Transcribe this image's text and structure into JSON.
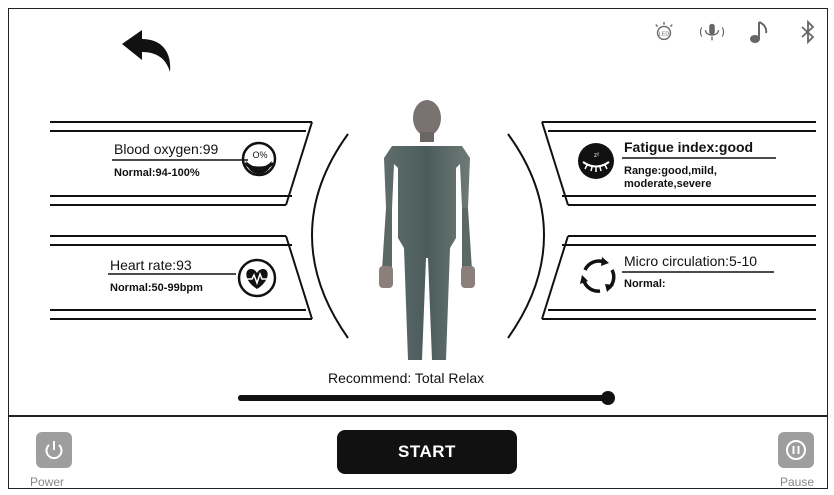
{
  "back_icon": "back-arrow-icon",
  "top_icons": [
    "led-icon",
    "microphone-icon",
    "music-note-icon",
    "bluetooth-icon"
  ],
  "top_icon_labels": {
    "led": "LED"
  },
  "blood_oxygen": {
    "label": "Blood oxygen:99",
    "normal": "Normal:94-100%",
    "icon": "oxygen-icon",
    "icon_text": "O%"
  },
  "heart_rate": {
    "label": "Heart rate:93",
    "normal": "Normal:50-99bpm",
    "icon": "heart-rate-icon"
  },
  "fatigue": {
    "label": "Fatigue index:good",
    "range_line1": "Range:good,mild,",
    "range_line2": "moderate,severe",
    "icon": "eye-icon"
  },
  "micro_circulation": {
    "label": "Micro circulation:5-10",
    "normal": "Normal:",
    "icon": "circulation-icon"
  },
  "body_figure": "human-body-figure",
  "recommend": "Recommend: Total Relax",
  "progress": 1.0,
  "power_label": "Power",
  "pause_label": "Pause",
  "start_label": "START"
}
